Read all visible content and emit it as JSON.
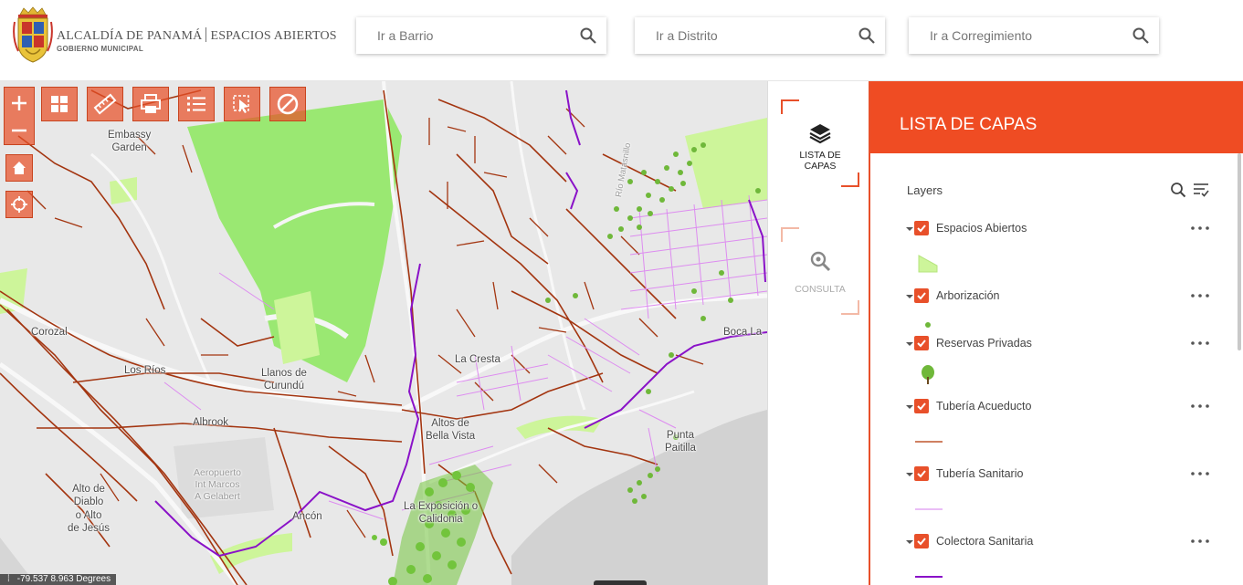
{
  "header": {
    "brand_title": "ALCALDÍA DE PANAMÁ",
    "brand_section": "ESPACIOS ABIERTOS",
    "brand_subtitle": "GOBIERNO MUNICIPAL",
    "searches": [
      {
        "placeholder": "Ir a Barrio",
        "icon": "search-icon"
      },
      {
        "placeholder": "Ir a Distrito",
        "icon": "search-icon"
      },
      {
        "placeholder": "Ir a Corregimiento",
        "icon": "search-icon"
      }
    ]
  },
  "map": {
    "toolbar": [
      {
        "icon": "zoom-in-icon"
      },
      {
        "icon": "basemap-gallery-icon"
      },
      {
        "icon": "measure-ruler-icon"
      },
      {
        "icon": "print-icon"
      },
      {
        "icon": "legend-list-icon"
      },
      {
        "icon": "select-features-icon"
      },
      {
        "icon": "clear-icon"
      }
    ],
    "nav": [
      {
        "icon": "home-icon"
      },
      {
        "icon": "locate-icon"
      }
    ],
    "labels": {
      "embassy": "Embassy\nGarden",
      "corozal": "Corozal",
      "los_rios": "Los Ríos",
      "llanos": "Llanos de\nCurundú",
      "albrook": "Albrook",
      "aeropuerto": "Aeropuerto\nInt Marcos\nA Gelabert",
      "alto_diablo": "Alto de\nDiablo\no Alto\nde Jesús",
      "ancon": "Ancón",
      "la_cresta": "La Cresta",
      "bella_vista": "Altos de\nBella Vista",
      "exposicion": "La Exposición o\nCalidonia",
      "punta_paitilla": "Punta\nPaitilla",
      "boca_la": "Boca La",
      "rio_road": "Río Matasnillo"
    },
    "coordinates": "-79.537 8.963 Degrees",
    "colors": {
      "base": "#e8e8e8",
      "green_space": "#9ae872",
      "acueducto": "#a33510",
      "sanitario": "#dd8cf0",
      "colectora": "#8a12c8",
      "arbol": "#6fb83a"
    }
  },
  "dock": {
    "tabs": [
      {
        "label": "LISTA DE\nCAPAS",
        "icon": "layers-icon",
        "active": true
      },
      {
        "label": "CONSULTA",
        "icon": "query-zoom-icon",
        "active": false
      }
    ]
  },
  "panel": {
    "header": "LISTA DE CAPAS",
    "title": "Layers",
    "accent": "#ef4c23",
    "layers": [
      {
        "name": "Espacios Abiertos",
        "checked": true,
        "legend": "polygon-green"
      },
      {
        "name": "Arborización",
        "checked": true,
        "legend": "dot-green"
      },
      {
        "name": "Reservas Privadas",
        "checked": true,
        "legend": "tree-icon"
      },
      {
        "name": "Tubería Acueducto",
        "checked": true,
        "legend": "line-rust"
      },
      {
        "name": "Tubería Sanitario",
        "checked": true,
        "legend": "line-pink"
      },
      {
        "name": "Colectora Sanitaria",
        "checked": true,
        "legend": "line-purple"
      }
    ]
  }
}
